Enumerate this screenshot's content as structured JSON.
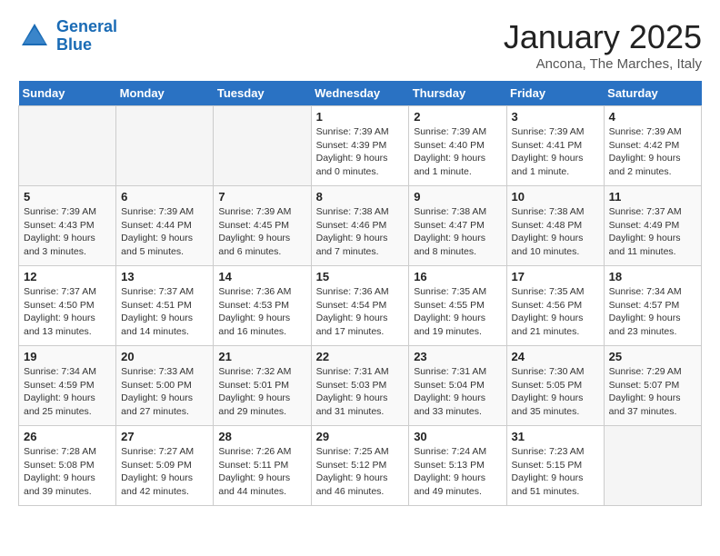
{
  "header": {
    "logo_line1": "General",
    "logo_line2": "Blue",
    "title": "January 2025",
    "subtitle": "Ancona, The Marches, Italy"
  },
  "weekdays": [
    "Sunday",
    "Monday",
    "Tuesday",
    "Wednesday",
    "Thursday",
    "Friday",
    "Saturday"
  ],
  "weeks": [
    [
      {
        "day": "",
        "sunrise": "",
        "sunset": "",
        "daylight": ""
      },
      {
        "day": "",
        "sunrise": "",
        "sunset": "",
        "daylight": ""
      },
      {
        "day": "",
        "sunrise": "",
        "sunset": "",
        "daylight": ""
      },
      {
        "day": "1",
        "sunrise": "Sunrise: 7:39 AM",
        "sunset": "Sunset: 4:39 PM",
        "daylight": "Daylight: 9 hours and 0 minutes."
      },
      {
        "day": "2",
        "sunrise": "Sunrise: 7:39 AM",
        "sunset": "Sunset: 4:40 PM",
        "daylight": "Daylight: 9 hours and 1 minute."
      },
      {
        "day": "3",
        "sunrise": "Sunrise: 7:39 AM",
        "sunset": "Sunset: 4:41 PM",
        "daylight": "Daylight: 9 hours and 1 minute."
      },
      {
        "day": "4",
        "sunrise": "Sunrise: 7:39 AM",
        "sunset": "Sunset: 4:42 PM",
        "daylight": "Daylight: 9 hours and 2 minutes."
      }
    ],
    [
      {
        "day": "5",
        "sunrise": "Sunrise: 7:39 AM",
        "sunset": "Sunset: 4:43 PM",
        "daylight": "Daylight: 9 hours and 3 minutes."
      },
      {
        "day": "6",
        "sunrise": "Sunrise: 7:39 AM",
        "sunset": "Sunset: 4:44 PM",
        "daylight": "Daylight: 9 hours and 5 minutes."
      },
      {
        "day": "7",
        "sunrise": "Sunrise: 7:39 AM",
        "sunset": "Sunset: 4:45 PM",
        "daylight": "Daylight: 9 hours and 6 minutes."
      },
      {
        "day": "8",
        "sunrise": "Sunrise: 7:38 AM",
        "sunset": "Sunset: 4:46 PM",
        "daylight": "Daylight: 9 hours and 7 minutes."
      },
      {
        "day": "9",
        "sunrise": "Sunrise: 7:38 AM",
        "sunset": "Sunset: 4:47 PM",
        "daylight": "Daylight: 9 hours and 8 minutes."
      },
      {
        "day": "10",
        "sunrise": "Sunrise: 7:38 AM",
        "sunset": "Sunset: 4:48 PM",
        "daylight": "Daylight: 9 hours and 10 minutes."
      },
      {
        "day": "11",
        "sunrise": "Sunrise: 7:37 AM",
        "sunset": "Sunset: 4:49 PM",
        "daylight": "Daylight: 9 hours and 11 minutes."
      }
    ],
    [
      {
        "day": "12",
        "sunrise": "Sunrise: 7:37 AM",
        "sunset": "Sunset: 4:50 PM",
        "daylight": "Daylight: 9 hours and 13 minutes."
      },
      {
        "day": "13",
        "sunrise": "Sunrise: 7:37 AM",
        "sunset": "Sunset: 4:51 PM",
        "daylight": "Daylight: 9 hours and 14 minutes."
      },
      {
        "day": "14",
        "sunrise": "Sunrise: 7:36 AM",
        "sunset": "Sunset: 4:53 PM",
        "daylight": "Daylight: 9 hours and 16 minutes."
      },
      {
        "day": "15",
        "sunrise": "Sunrise: 7:36 AM",
        "sunset": "Sunset: 4:54 PM",
        "daylight": "Daylight: 9 hours and 17 minutes."
      },
      {
        "day": "16",
        "sunrise": "Sunrise: 7:35 AM",
        "sunset": "Sunset: 4:55 PM",
        "daylight": "Daylight: 9 hours and 19 minutes."
      },
      {
        "day": "17",
        "sunrise": "Sunrise: 7:35 AM",
        "sunset": "Sunset: 4:56 PM",
        "daylight": "Daylight: 9 hours and 21 minutes."
      },
      {
        "day": "18",
        "sunrise": "Sunrise: 7:34 AM",
        "sunset": "Sunset: 4:57 PM",
        "daylight": "Daylight: 9 hours and 23 minutes."
      }
    ],
    [
      {
        "day": "19",
        "sunrise": "Sunrise: 7:34 AM",
        "sunset": "Sunset: 4:59 PM",
        "daylight": "Daylight: 9 hours and 25 minutes."
      },
      {
        "day": "20",
        "sunrise": "Sunrise: 7:33 AM",
        "sunset": "Sunset: 5:00 PM",
        "daylight": "Daylight: 9 hours and 27 minutes."
      },
      {
        "day": "21",
        "sunrise": "Sunrise: 7:32 AM",
        "sunset": "Sunset: 5:01 PM",
        "daylight": "Daylight: 9 hours and 29 minutes."
      },
      {
        "day": "22",
        "sunrise": "Sunrise: 7:31 AM",
        "sunset": "Sunset: 5:03 PM",
        "daylight": "Daylight: 9 hours and 31 minutes."
      },
      {
        "day": "23",
        "sunrise": "Sunrise: 7:31 AM",
        "sunset": "Sunset: 5:04 PM",
        "daylight": "Daylight: 9 hours and 33 minutes."
      },
      {
        "day": "24",
        "sunrise": "Sunrise: 7:30 AM",
        "sunset": "Sunset: 5:05 PM",
        "daylight": "Daylight: 9 hours and 35 minutes."
      },
      {
        "day": "25",
        "sunrise": "Sunrise: 7:29 AM",
        "sunset": "Sunset: 5:07 PM",
        "daylight": "Daylight: 9 hours and 37 minutes."
      }
    ],
    [
      {
        "day": "26",
        "sunrise": "Sunrise: 7:28 AM",
        "sunset": "Sunset: 5:08 PM",
        "daylight": "Daylight: 9 hours and 39 minutes."
      },
      {
        "day": "27",
        "sunrise": "Sunrise: 7:27 AM",
        "sunset": "Sunset: 5:09 PM",
        "daylight": "Daylight: 9 hours and 42 minutes."
      },
      {
        "day": "28",
        "sunrise": "Sunrise: 7:26 AM",
        "sunset": "Sunset: 5:11 PM",
        "daylight": "Daylight: 9 hours and 44 minutes."
      },
      {
        "day": "29",
        "sunrise": "Sunrise: 7:25 AM",
        "sunset": "Sunset: 5:12 PM",
        "daylight": "Daylight: 9 hours and 46 minutes."
      },
      {
        "day": "30",
        "sunrise": "Sunrise: 7:24 AM",
        "sunset": "Sunset: 5:13 PM",
        "daylight": "Daylight: 9 hours and 49 minutes."
      },
      {
        "day": "31",
        "sunrise": "Sunrise: 7:23 AM",
        "sunset": "Sunset: 5:15 PM",
        "daylight": "Daylight: 9 hours and 51 minutes."
      },
      {
        "day": "",
        "sunrise": "",
        "sunset": "",
        "daylight": ""
      }
    ]
  ]
}
